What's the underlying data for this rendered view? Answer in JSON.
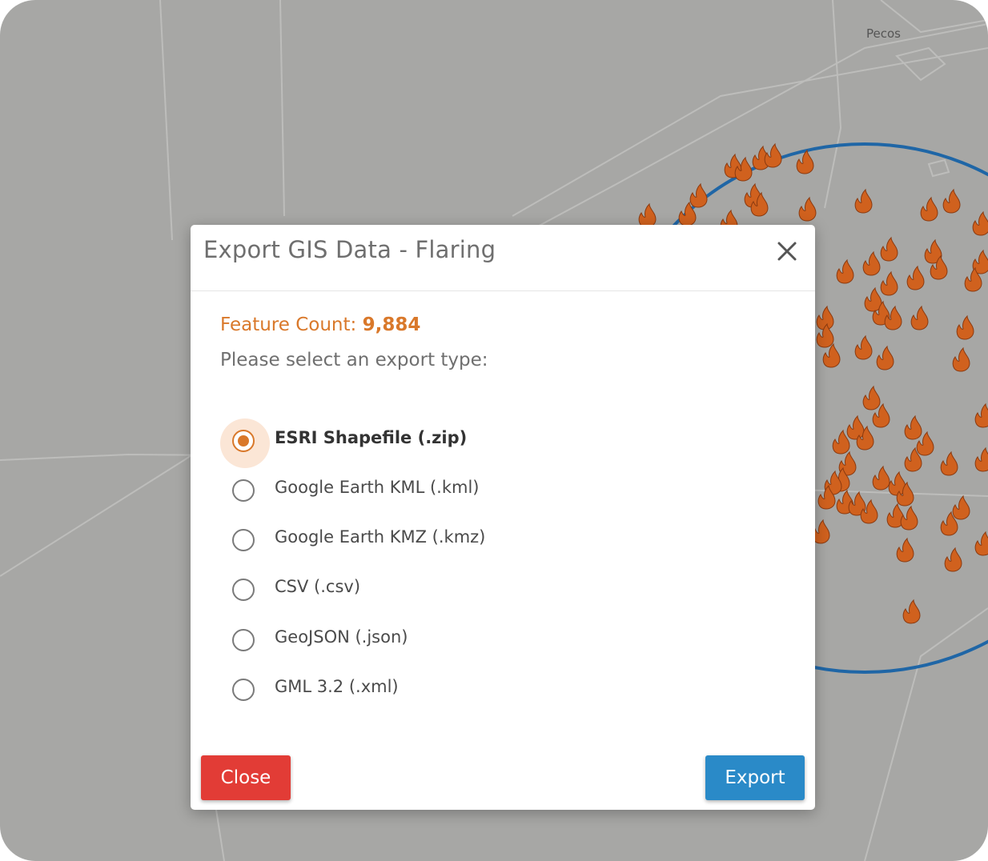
{
  "map": {
    "place_label": "Pecos",
    "radius_color": "#1f66a6",
    "marker_color": "#d0611e",
    "marker_icon": "fire-icon"
  },
  "modal": {
    "title": "Export GIS Data - Flaring",
    "close_icon": "close-icon",
    "feature_count_label": "Feature Count: ",
    "feature_count_value": "9,884",
    "prompt": "Please select an export type:",
    "accent_color": "#d9782a",
    "options": [
      {
        "label": "ESRI Shapefile (.zip)",
        "selected": true
      },
      {
        "label": "Google Earth KML (.kml)",
        "selected": false
      },
      {
        "label": "Google Earth KMZ (.kmz)",
        "selected": false
      },
      {
        "label": "CSV (.csv)",
        "selected": false
      },
      {
        "label": "GeoJSON (.json)",
        "selected": false
      },
      {
        "label": "GML 3.2 (.xml)",
        "selected": false
      }
    ],
    "close_button": "Close",
    "export_button": "Export",
    "close_button_color": "#e23c36",
    "export_button_color": "#2a8ac8"
  }
}
